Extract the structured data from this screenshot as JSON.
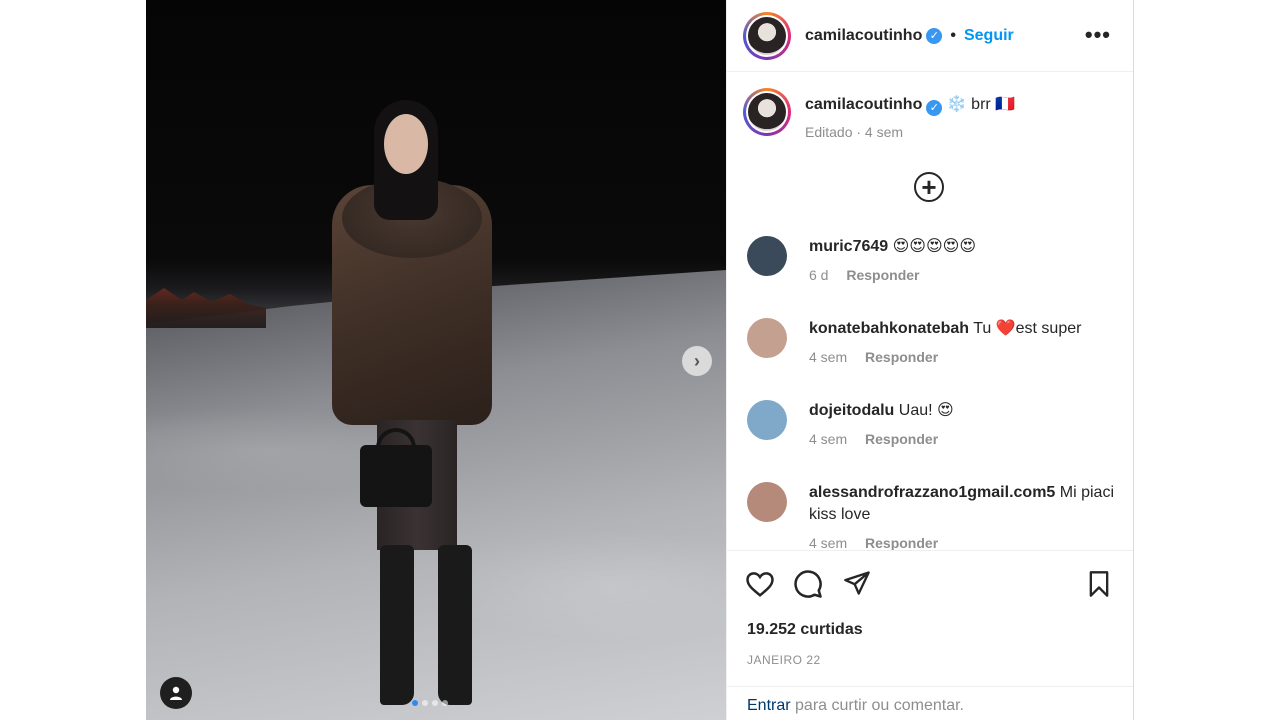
{
  "post": {
    "image_alt": "",
    "carousel": {
      "total": 4,
      "current": 1
    }
  },
  "header": {
    "username": "camilacoutinho",
    "separator": "•",
    "follow_label": "Seguir",
    "more_label": "•••"
  },
  "caption": {
    "username": "camilacoutinho",
    "text": "❄️ brr 🇫🇷",
    "meta": "Editado · 4 sem"
  },
  "load_more_label": "+",
  "comments": [
    {
      "username": "muric7649",
      "text": "😍😍😍😍😍",
      "time": "6 d",
      "reply": "Responder",
      "avatar_color": "#3a4a5a"
    },
    {
      "username": "konatebahkonatebah",
      "text": "Tu ❤️est super",
      "time": "4 sem",
      "reply": "Responder",
      "avatar_color": "#c4a090"
    },
    {
      "username": "dojeitodalu",
      "text": "Uau! 😍",
      "time": "4 sem",
      "reply": "Responder",
      "avatar_color": "#7fa8c9"
    },
    {
      "username": "alessandrofrazzano1gmail.com5",
      "text": "Mi piaci kiss love",
      "time": "4 sem",
      "reply": "Responder",
      "avatar_color": "#b58a7a"
    }
  ],
  "actions": {
    "likes": "19.252 curtidas",
    "date": "JANEIRO 22"
  },
  "footer": {
    "enter_label": "Entrar",
    "rest": "para curtir ou comentar."
  }
}
